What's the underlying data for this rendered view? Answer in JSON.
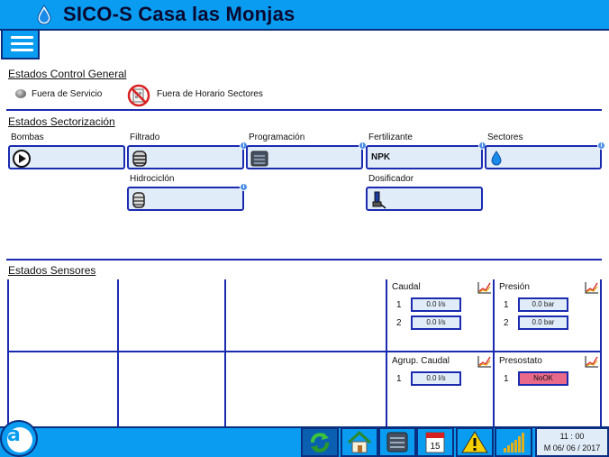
{
  "header": {
    "title": "SICO-S Casa las Monjas",
    "icon": "water-drop-icon"
  },
  "menu": {
    "icon": "hamburger-menu-icon"
  },
  "control_general": {
    "title": "Estados Control General",
    "items": [
      {
        "label": "Fuera de Servicio",
        "icon": "grey-status-ball-icon"
      },
      {
        "label": "Fuera de Horario Sectores",
        "icon": "no-schedule-icon"
      }
    ]
  },
  "sectorizacion": {
    "title": "Estados Sectorización",
    "devices": [
      {
        "label": "Bombas",
        "icon": "pump-play-icon"
      },
      {
        "label": "Filtrado",
        "icon": "filter-icon"
      },
      {
        "label": "Programación",
        "icon": "program-list-icon"
      },
      {
        "label": "Fertilizante",
        "value": "NPK"
      },
      {
        "label": "Sectores",
        "icon": "water-drop-icon"
      },
      {
        "label": "Hidrociclón",
        "icon": "hydrocyclone-icon"
      },
      {
        "label": "Dosificador",
        "icon": "doser-icon"
      }
    ]
  },
  "sensores": {
    "title": "Estados Sensores",
    "caudal": {
      "title": "Caudal",
      "rows": [
        {
          "idx": "1",
          "value": "0.0 l/s"
        },
        {
          "idx": "2",
          "value": "0.0 l/s"
        }
      ]
    },
    "presion": {
      "title": "Presión",
      "rows": [
        {
          "idx": "1",
          "value": "0.0 bar"
        },
        {
          "idx": "2",
          "value": "0.0 bar"
        }
      ]
    },
    "agrup_caudal": {
      "title": "Agrup. Caudal",
      "rows": [
        {
          "idx": "1",
          "value": "0.0 l/s"
        }
      ]
    },
    "presostato": {
      "title": "Presostato",
      "rows": [
        {
          "idx": "1",
          "value": "NoOK",
          "status_color": "#e8698a"
        }
      ]
    }
  },
  "bottom_bar": {
    "buttons": [
      "refresh-icon",
      "home-icon",
      "program-list-icon",
      "calendar-icon",
      "warning-icon",
      "signal-icon"
    ],
    "calendar_day": "15",
    "clock_time": "11 : 00",
    "clock_date": "M 06/ 06 / 2017"
  },
  "colors": {
    "header_blue": "#0a9cf0",
    "border_navy": "#1a2bb0",
    "box_fill": "#e1ecf9",
    "alarm_pink": "#e8698a"
  }
}
